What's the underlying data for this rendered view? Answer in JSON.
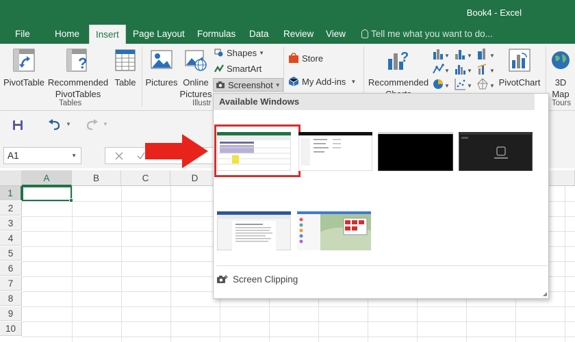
{
  "window": {
    "title": "Book4 - Excel"
  },
  "tabs": [
    "File",
    "Home",
    "Insert",
    "Page Layout",
    "Formulas",
    "Data",
    "Review",
    "View"
  ],
  "active_tab": "Insert",
  "tell_me": {
    "placeholder": "Tell me what you want to do..."
  },
  "ribbon": {
    "tables_group": {
      "label": "Tables",
      "pivottable": "PivotTable",
      "recommended_pivottables": [
        "Recommended",
        "PivotTables"
      ],
      "table": "Table"
    },
    "illustrations_group": {
      "label": "Illustr",
      "pictures": "Pictures",
      "online_pictures": [
        "Online",
        "Pictures"
      ],
      "shapes": "Shapes",
      "smartart": "SmartArt",
      "screenshot": "Screenshot"
    },
    "addins_group": {
      "store": "Store",
      "my_addins": "My Add-ins"
    },
    "charts_group": {
      "recommended_charts": [
        "Recommended",
        "Charts"
      ],
      "pivotchart": "PivotChart"
    },
    "tours_group": {
      "label": "Tours",
      "map": [
        "3D",
        "Map"
      ]
    }
  },
  "formula_bar": {
    "name_box": "A1"
  },
  "grid": {
    "columns": [
      "A",
      "B",
      "C",
      "D"
    ],
    "rows": [
      "1",
      "2",
      "3",
      "4",
      "5",
      "6",
      "7",
      "8",
      "9",
      "10"
    ],
    "selected_cell": "A1"
  },
  "screenshot_panel": {
    "header": "Available Windows",
    "screen_clipping": "Screen Clipping",
    "window_count": 6
  },
  "colors": {
    "brand": "#217346",
    "highlight": "#d32f2f",
    "arrow": "#e8231b"
  }
}
